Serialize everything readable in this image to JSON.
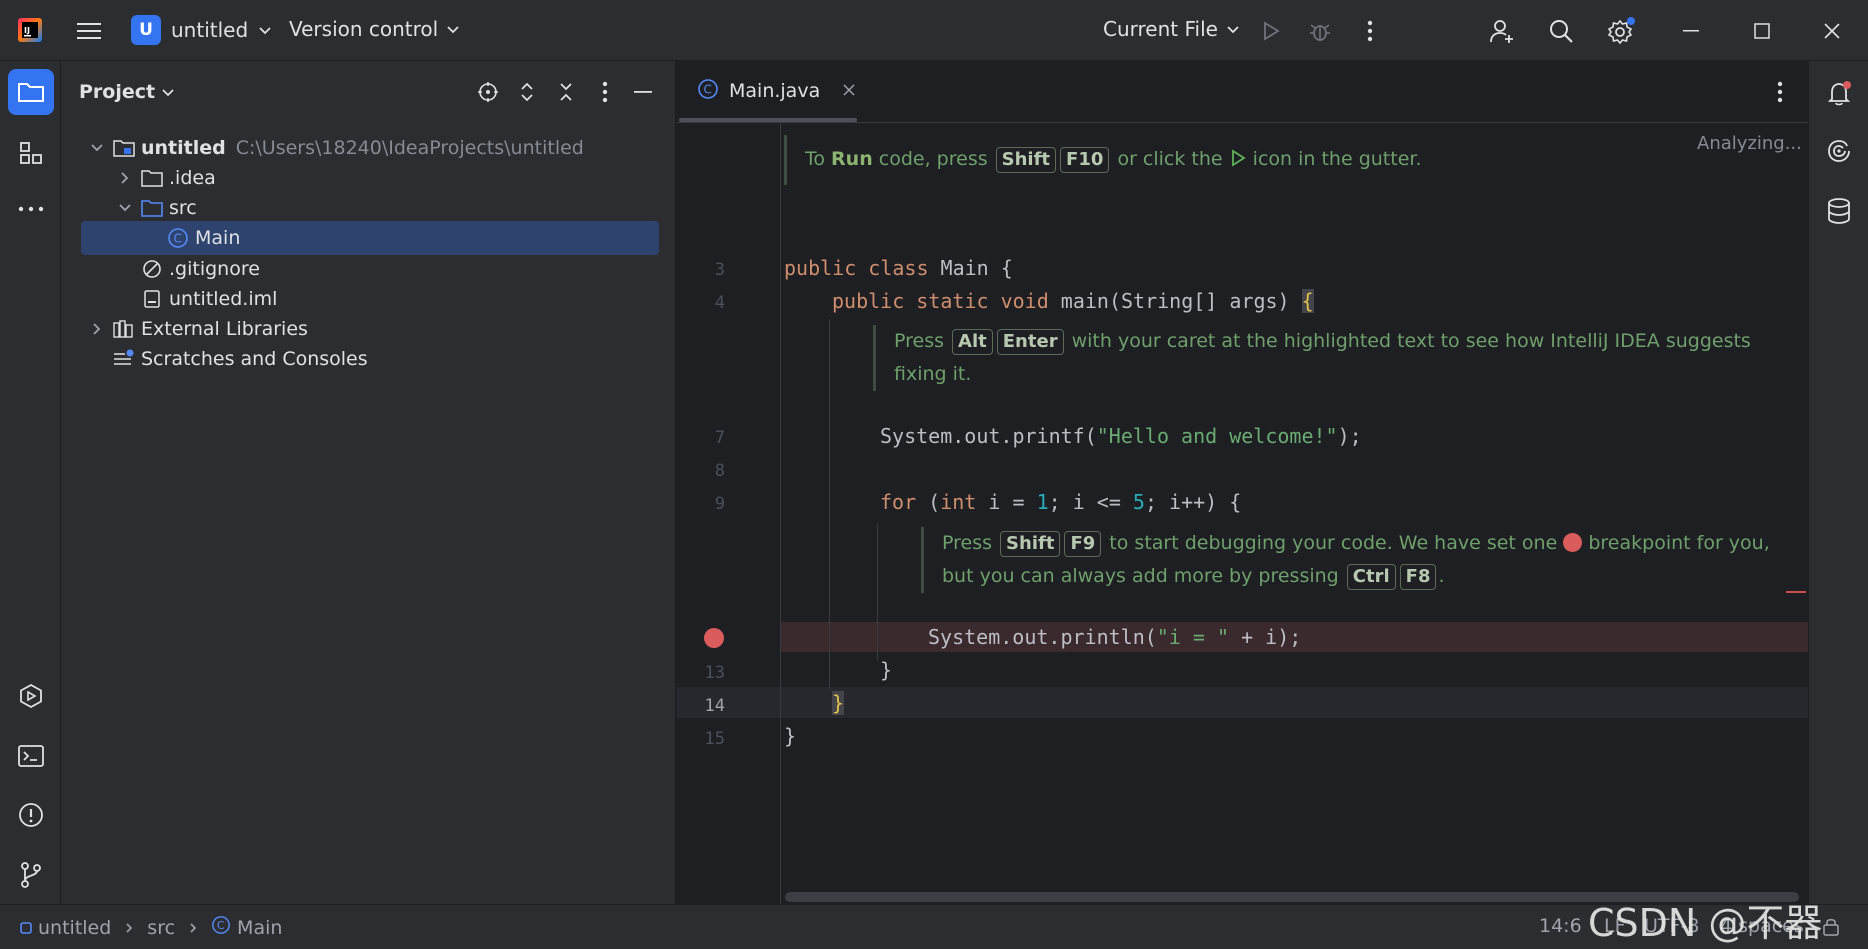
{
  "titlebar": {
    "project_badge": "U",
    "project_name": "untitled",
    "version_control": "Version control",
    "run_config": "Current File"
  },
  "project_panel": {
    "title": "Project",
    "tree": [
      {
        "label": "untitled",
        "path": "C:\\Users\\18240\\IdeaProjects\\untitled"
      },
      {
        "label": ".idea"
      },
      {
        "label": "src"
      },
      {
        "label": "Main"
      },
      {
        "label": ".gitignore"
      },
      {
        "label": "untitled.iml"
      },
      {
        "label": "External Libraries"
      },
      {
        "label": "Scratches and Consoles"
      }
    ]
  },
  "editor": {
    "tab_label": "Main.java",
    "status": "Analyzing...",
    "line_numbers": [
      "3",
      "4",
      "7",
      "8",
      "9",
      "13",
      "14",
      "15"
    ],
    "hint_run": {
      "pre": "To ",
      "bold": "Run",
      "mid": " code, press ",
      "k1": "Shift",
      "k2": "F10",
      "post": " or click the ",
      "post2": " icon in the gutter."
    },
    "hint_fix": {
      "pre": "Press ",
      "k1": "Alt",
      "k2": "Enter",
      "post": " with your caret at the highlighted text to see how IntelliJ IDEA suggests",
      "line2": "fixing it."
    },
    "hint_debug": {
      "pre": "Press ",
      "k1": "Shift",
      "k2": "F9",
      "post": " to start debugging your code. We have set one ",
      "post2": " breakpoint for you,",
      "line2a": "but you can always add more by pressing ",
      "k3": "Ctrl",
      "k4": "F8",
      "line2b": "."
    }
  },
  "statusbar": {
    "crumbs": [
      "untitled",
      "src",
      "Main"
    ],
    "position": "14:6",
    "line_sep": "LF",
    "encoding": "UTF-8",
    "indent": "4 spaces"
  },
  "watermark": "CSDN @不器729",
  "colors": {
    "accent": "#3574f0",
    "breakpoint": "#db5c5c",
    "keyword": "#cf8e6d",
    "string": "#6aab73",
    "number": "#2aacb8"
  }
}
